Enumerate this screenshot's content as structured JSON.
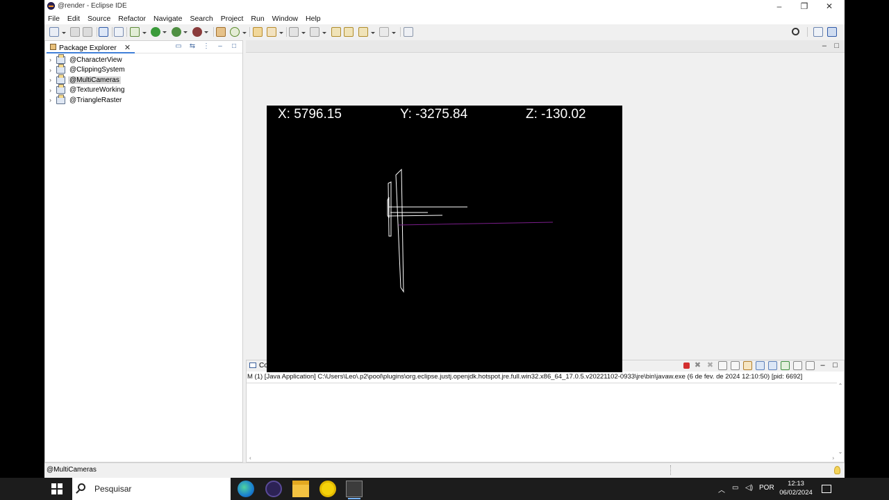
{
  "window": {
    "title": "@render - Eclipse IDE",
    "controls": {
      "minimize": "–",
      "restore": "❐",
      "close": "✕"
    }
  },
  "menu": [
    "File",
    "Edit",
    "Source",
    "Refactor",
    "Navigate",
    "Search",
    "Project",
    "Run",
    "Window",
    "Help"
  ],
  "package_explorer": {
    "tab_label": "Package Explorer",
    "close_glyph": "✕",
    "projects": [
      {
        "name": "@CharacterView",
        "selected": false
      },
      {
        "name": "@ClippingSystem",
        "selected": false
      },
      {
        "name": "@MultiCameras",
        "selected": true
      },
      {
        "name": "@TextureWorking",
        "selected": false
      },
      {
        "name": "@TriangleRaster",
        "selected": false
      }
    ]
  },
  "console": {
    "tab_label": "Co",
    "description": "M (1) [Java Application] C:\\Users\\Leo\\.p2\\pool\\plugins\\org.eclipse.justj.openjdk.hotspot.jre.full.win32.x86_64_17.0.5.v20221102-0933\\jre\\bin\\javaw.exe  (6 de fev. de 2024 12:10:50) [pid: 6692]"
  },
  "render_window": {
    "x_readout": "X: 5796.15",
    "y_readout": "Y: -3275.84",
    "z_readout": "Z: -130.02",
    "line_color": "#ffffff",
    "accent_line_color": "#7b1e8c"
  },
  "status_bar": {
    "selection": "@MultiCameras"
  },
  "taskbar": {
    "search_placeholder": "Pesquisar",
    "language": "POR",
    "time": "12:13",
    "date": "06/02/2024",
    "apps": [
      "edge-icon",
      "eclipse-icon",
      "file-explorer-icon",
      "search-tool-icon",
      "java-app-icon"
    ]
  },
  "colors": {
    "eclipse_bg": "#f0f0f0",
    "selection": "#d9d9d9",
    "taskbar": "#1c1c1c",
    "run_green": "#3a9b3a",
    "terminate_red": "#d32f2f"
  }
}
